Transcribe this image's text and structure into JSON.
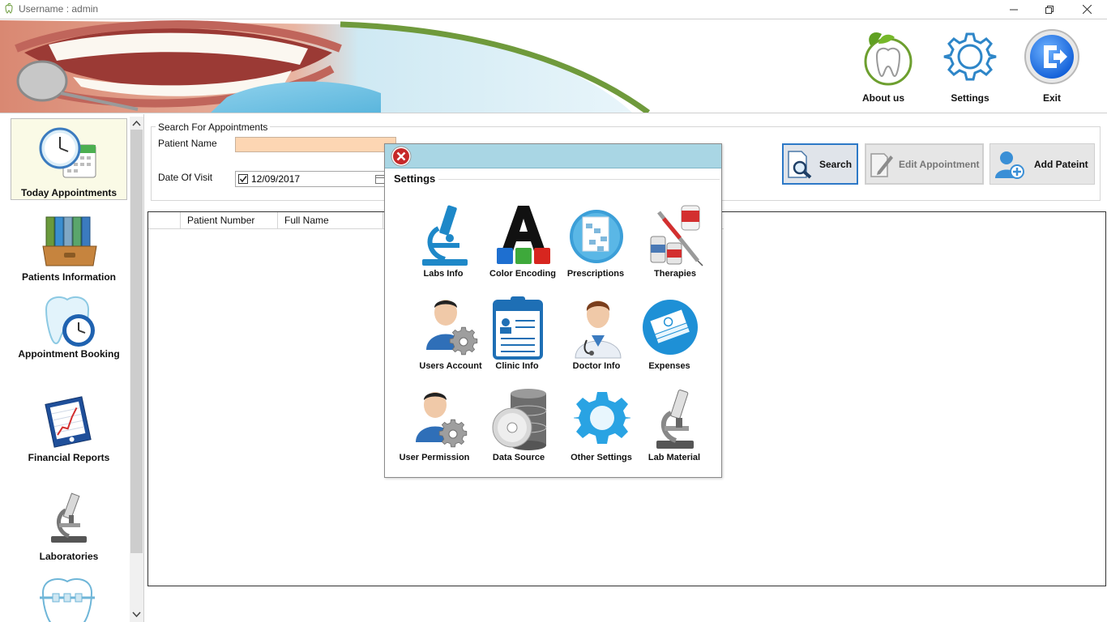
{
  "titlebar": {
    "title": "Username : admin",
    "minimize": "minimize",
    "restore": "restore",
    "close": "close"
  },
  "header": {
    "about_label": "About us",
    "settings_label": "Settings",
    "exit_label": "Exit"
  },
  "nav": {
    "items": [
      {
        "label": "Today Appointments",
        "icon": "calendar-clock-icon",
        "active": true
      },
      {
        "label": "Patients Information",
        "icon": "binders-icon"
      },
      {
        "label": "Appointment Booking",
        "icon": "tooth-clock-icon"
      },
      {
        "label": "Financial Reports",
        "icon": "chart-report-icon"
      },
      {
        "label": "Laboratories",
        "icon": "microscope-icon"
      },
      {
        "label": "",
        "icon": "braces-tooth-icon"
      }
    ]
  },
  "search": {
    "legend": "Search For Appointments",
    "patient_name_label": "Patient Name",
    "patient_name_value": "",
    "date_label": "Date Of Visit",
    "date_value": "12/09/2017",
    "date_checked": true,
    "search_button": "Search",
    "edit_button": "Edit Appointment",
    "add_button": "Add Pateint"
  },
  "grid": {
    "columns": [
      "",
      "Patient Number",
      "Full Name"
    ]
  },
  "dialog": {
    "title": "Settings",
    "items": [
      {
        "label": "Labs Info",
        "icon": "microscope-icon"
      },
      {
        "label": "Color Encoding",
        "icon": "letter-a-icon"
      },
      {
        "label": "Prescriptions",
        "icon": "prescription-icon"
      },
      {
        "label": "Therapies",
        "icon": "syringe-icon"
      },
      {
        "label": "Users Account",
        "icon": "user-gear-icon"
      },
      {
        "label": "Clinic Info",
        "icon": "clipboard-icon"
      },
      {
        "label": "Doctor Info",
        "icon": "doctor-icon"
      },
      {
        "label": "Expenses",
        "icon": "money-icon"
      },
      {
        "label": "User Permission",
        "icon": "user-gear-icon"
      },
      {
        "label": "Data Source",
        "icon": "database-icon"
      },
      {
        "label": "Other Settings",
        "icon": "gear-icon"
      },
      {
        "label": "Lab Material",
        "icon": "microscope-icon"
      }
    ]
  },
  "colors": {
    "accent": "#2d79c7",
    "dialog_header": "#a9d6e4",
    "input_highlight": "#fdd6b3",
    "close_red": "#c62828"
  }
}
